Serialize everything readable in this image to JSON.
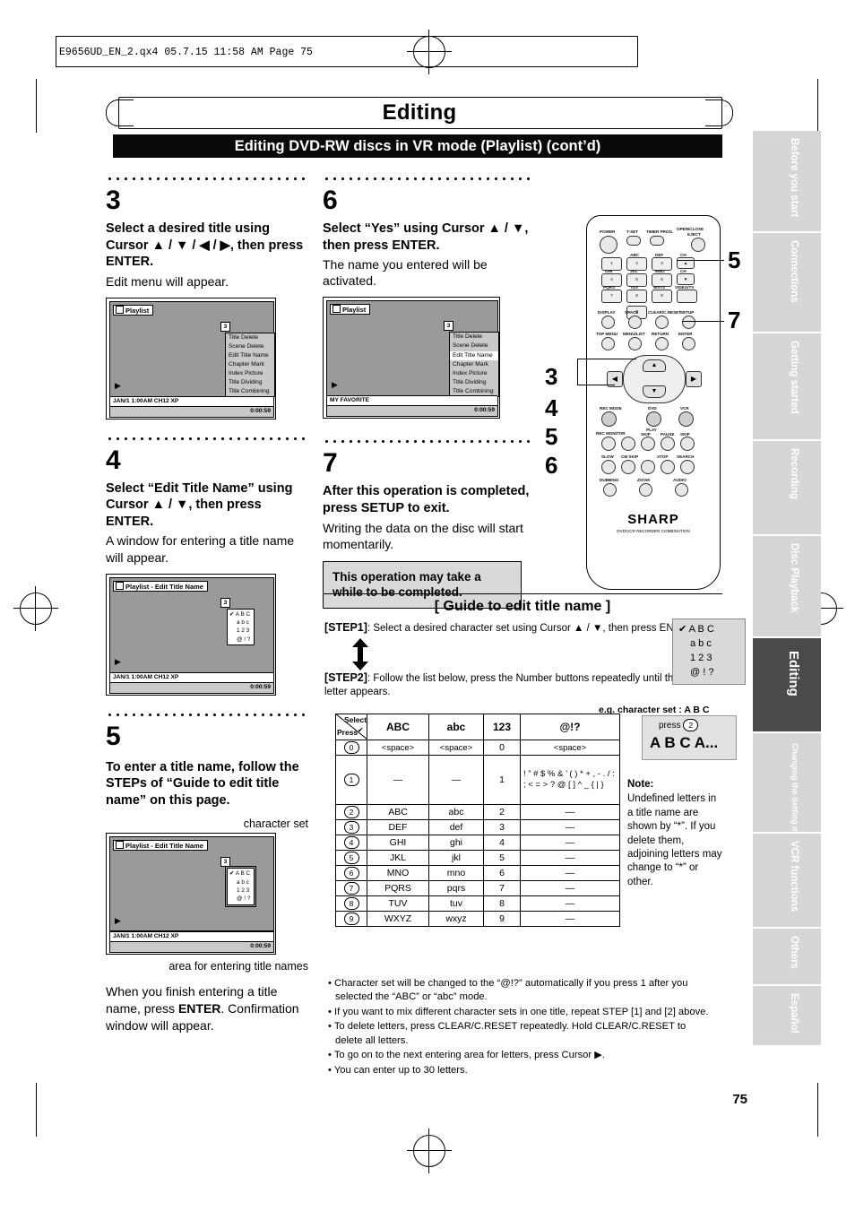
{
  "print_header": "E9656UD_EN_2.qx4   05.7.15   11:58 AM   Page 75",
  "page_number": "75",
  "doc": {
    "title": "Editing",
    "section_bar": "Editing DVD-RW discs in VR mode (Playlist) (cont’d)"
  },
  "side_tabs": [
    {
      "label": "Before you start",
      "active": false
    },
    {
      "label": "Connections",
      "active": false
    },
    {
      "label": "Getting started",
      "active": false
    },
    {
      "label": "Recording",
      "active": false
    },
    {
      "label": "Disc Playback",
      "active": false
    },
    {
      "label": "Editing",
      "active": true
    },
    {
      "label": "Changing the Setting menu",
      "active": false
    },
    {
      "label": "VCR functions",
      "active": false
    },
    {
      "label": "Others",
      "active": false
    },
    {
      "label": "Español",
      "active": false
    }
  ],
  "steps": {
    "s3": {
      "num": "3",
      "bold": "Select a desired title using Cursor ▲ / ▼ / ◀ / ▶, then press ENTER.",
      "plain": "Edit menu will appear."
    },
    "s4": {
      "num": "4",
      "bold": "Select “Edit Title Name” using Cursor ▲ / ▼, then press ENTER.",
      "plain": "A window for entering a title name will appear."
    },
    "s5": {
      "num": "5",
      "bold": "To enter a title name, follow the STEPs of “Guide to edit title name” on this page.",
      "caption_charset": "character set",
      "caption_area": "area for entering title names",
      "plain": "When you finish entering a title name, press ENTER. Confirmation window will appear.",
      "plain_pre": "When you finish entering a title name, press ",
      "plain_bold": "ENTER",
      "plain_post": ". Confirmation window will appear."
    },
    "s6": {
      "num": "6",
      "bold": "Select “Yes” using Cursor ▲ / ▼, then press ENTER.",
      "plain": "The name you entered will be activated."
    },
    "s7": {
      "num": "7",
      "bold": "After this operation is completed, press SETUP to exit.",
      "plain": "Writing the data on the disc will start momentarily.",
      "note": "This operation may take a while to be completed."
    }
  },
  "osd": {
    "playlist_title": "Playlist",
    "edit_title_name_title": "Playlist - Edit Title Name",
    "menu_items": [
      "Title Delete",
      "Scene Delete",
      "Edit Title Name",
      "Chapter Mark",
      "Index Picture",
      "Title Dividing",
      "Title Combining"
    ],
    "menu_selected": "Edit Title Name",
    "bottom_left_default": "JAN/1 1:00AM CH12 XP",
    "bottom_left_favorite": "MY FAVORITE",
    "bottom_right": "0:00:59",
    "thumb_index": "3",
    "charset_rows": [
      "A B C",
      "a b c",
      "1 2 3",
      "@ ! ?"
    ]
  },
  "remote": {
    "brand": "SHARP",
    "sub_brand": "DVD/VCR RECORDER COMBINATION",
    "labels": {
      "power": "POWER",
      "tset": "T-SET",
      "timer_prog": "TIMER PROG.",
      "open_close": "OPEN/CLOSE",
      "eject": "EJECT",
      "display": "DISPLAY",
      "space": "SPACE",
      "clear": "CLEAR/C.RESET",
      "setup": "SETUP",
      "top_menu": "TOP MENU",
      "menu": "MENU/LIST",
      "return": "RETURN",
      "enter": "ENTER",
      "rec_monitor": "REC MONITOR",
      "skip_back": "SKIP",
      "play": "PLAY",
      "pause": "PAUSE",
      "skip_fwd": "SKIP",
      "slow": "SLOW",
      "cm_skip": "CM SKIP",
      "stop": "STOP",
      "search": "SEARCH",
      "dubbing": "DUBBING",
      "zoom": "ZOOM",
      "audio": "AUDIO",
      "rec_mode": "REC MODE",
      "dvd": "DVD",
      "vcr": "VCR",
      "abc": "ABC",
      "def": "DEF",
      "ghi": "GHI",
      "jkl": "JKL",
      "mno": "MNO",
      "pqrs": "PQRS",
      "tuv": "TUV",
      "wxyz": "WXYZ",
      "video_tv": "VIDEO/TV",
      "ch_up": "CH",
      "ch_down": "CH"
    },
    "callouts": [
      "5",
      "7",
      "3",
      "4",
      "5",
      "6"
    ]
  },
  "guide": {
    "heading": "[ Guide to edit title name ]",
    "step1_tag": "[STEP1]",
    "step1_text": ": Select a desired character set using Cursor ▲ / ▼, then press ENTER.",
    "step2_tag": "[STEP2]",
    "step2_text": ": Follow the list below, press the Number buttons repeatedly until the desired letter appears.",
    "example_label": "e.g. character set : A B C",
    "press_label": "press",
    "press_key": "2",
    "press_sequence": "A  B  C  A...",
    "charset_side": [
      "A B C",
      "a b c",
      "1 2 3",
      "@ ! ?"
    ],
    "table": {
      "corner_top": "Select",
      "corner_bottom": "Press",
      "columns": [
        "ABC",
        "abc",
        "123",
        "@!?"
      ],
      "rows": [
        {
          "key": "0",
          "abc": "<space>",
          "lower": "<space>",
          "num": "0",
          "sym": "<space>"
        },
        {
          "key": "1",
          "abc": "—",
          "lower": "—",
          "num": "1",
          "sym": "! ” # $ % & ’ ( ) * + , - . / : ; < = > ? @ [ ] ^ _ { | }"
        },
        {
          "key": "2",
          "abc": "ABC",
          "lower": "abc",
          "num": "2",
          "sym": "—"
        },
        {
          "key": "3",
          "abc": "DEF",
          "lower": "def",
          "num": "3",
          "sym": "—"
        },
        {
          "key": "4",
          "abc": "GHI",
          "lower": "ghi",
          "num": "4",
          "sym": "—"
        },
        {
          "key": "5",
          "abc": "JKL",
          "lower": "jkl",
          "num": "5",
          "sym": "—"
        },
        {
          "key": "6",
          "abc": "MNO",
          "lower": "mno",
          "num": "6",
          "sym": "—"
        },
        {
          "key": "7",
          "abc": "PQRS",
          "lower": "pqrs",
          "num": "7",
          "sym": "—"
        },
        {
          "key": "8",
          "abc": "TUV",
          "lower": "tuv",
          "num": "8",
          "sym": "—"
        },
        {
          "key": "9",
          "abc": "WXYZ",
          "lower": "wxyz",
          "num": "9",
          "sym": "—"
        }
      ]
    },
    "note": {
      "title": "Note:",
      "text": "Undefined letters in a title name are shown by “*”.  If you delete them, adjoining letters may change to “*” or other."
    },
    "bullets": [
      "• Character set will be changed to the “@!?” automatically if you press  1  after you selected the “ABC” or “abc” mode.",
      "• If you want to mix different character sets in one title, repeat STEP [1] and [2] above.",
      "• To delete letters, press CLEAR/C.RESET repeatedly. Hold CLEAR/C.RESET to delete all letters.",
      "• To go on to the next entering area for letters, press Cursor ▶.",
      "• You can enter up to 30 letters."
    ]
  }
}
